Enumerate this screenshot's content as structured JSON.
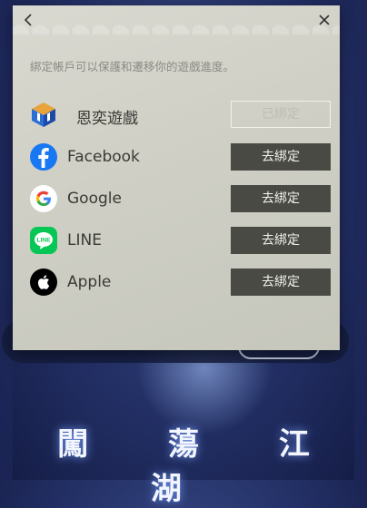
{
  "dialog": {
    "hint": "綁定帳戶可以保護和遷移你的遊戲進度。"
  },
  "accounts": [
    {
      "name": "恩奕遊戲",
      "action": "已綁定",
      "icon": "nx-cube-icon"
    },
    {
      "name": "Facebook",
      "action": "去綁定",
      "icon": "facebook-icon"
    },
    {
      "name": "Google",
      "action": "去綁定",
      "icon": "google-icon"
    },
    {
      "name": "LINE",
      "action": "去綁定",
      "icon": "line-icon"
    },
    {
      "name": "Apple",
      "action": "去綁定",
      "icon": "apple-icon"
    }
  ],
  "background": {
    "title": "闖 蕩 江 湖"
  },
  "colors": {
    "button": "#4a4a45",
    "dialog": "#cfcfc5",
    "facebook": "#1877f2",
    "line": "#06c755"
  }
}
